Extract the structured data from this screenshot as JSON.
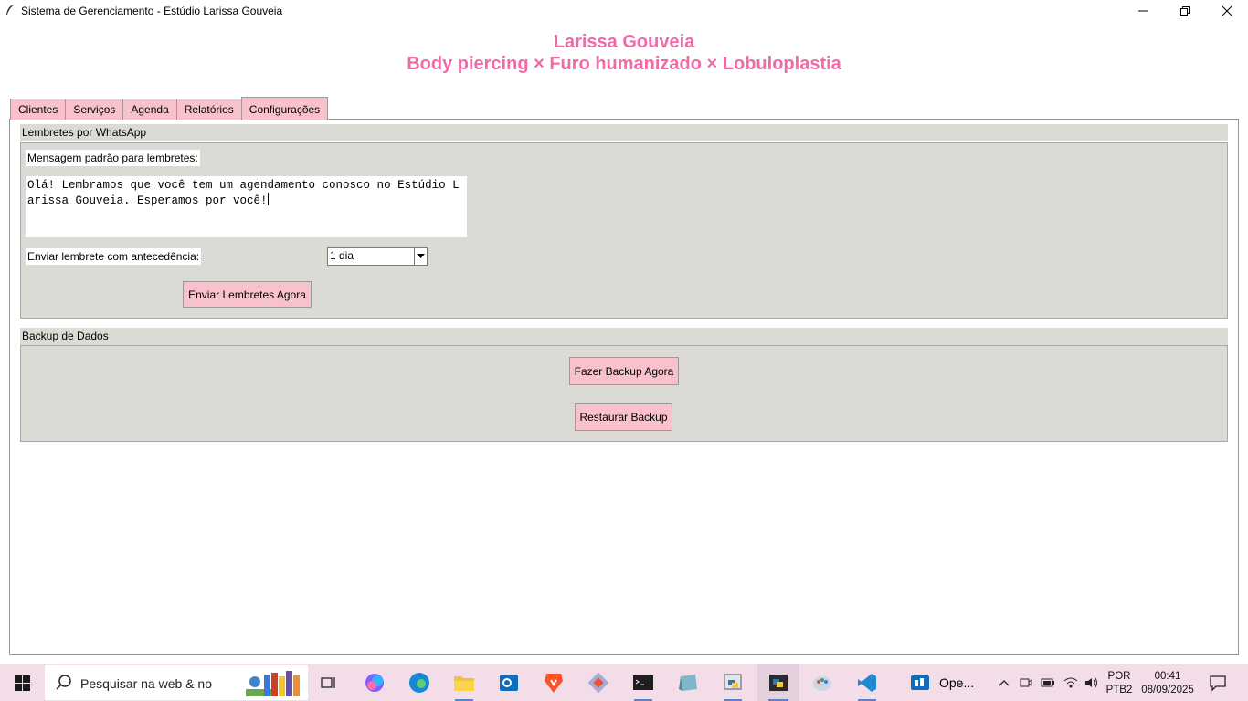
{
  "window": {
    "title": "Sistema de Gerenciamento - Estúdio Larissa Gouveia"
  },
  "header": {
    "name": "Larissa Gouveia",
    "subtitle": "Body piercing × Furo humanizado × Lobuloplastia",
    "color": "#ef6aa6"
  },
  "tabs": [
    {
      "label": "Clientes"
    },
    {
      "label": "Serviços"
    },
    {
      "label": "Agenda"
    },
    {
      "label": "Relatórios"
    },
    {
      "label": "Configurações",
      "active": true
    }
  ],
  "whatsapp": {
    "group_title": "Lembretes por WhatsApp",
    "message_label": "Mensagem padrão para lembretes:",
    "message_value": "Olá! Lembramos que você tem um agendamento conosco no Estúdio Larissa Gouveia. Esperamos por você!",
    "advance_label": "Enviar lembrete com antecedência:",
    "advance_value": "1 dia",
    "send_button": "Enviar Lembretes Agora"
  },
  "backup": {
    "group_title": "Backup de Dados",
    "backup_button": "Fazer Backup Agora",
    "restore_button": "Restaurar Backup"
  },
  "taskbar": {
    "search_placeholder": "Pesquisar na web & no",
    "open_app_label": "Ope...",
    "lang_top": "POR",
    "lang_bottom": "PTB2",
    "time": "00:41",
    "date": "08/09/2025"
  },
  "colors": {
    "accent_pink": "#f9c1cb",
    "group_bg": "#dcdad5",
    "taskbar_bg": "#f2dde9"
  }
}
